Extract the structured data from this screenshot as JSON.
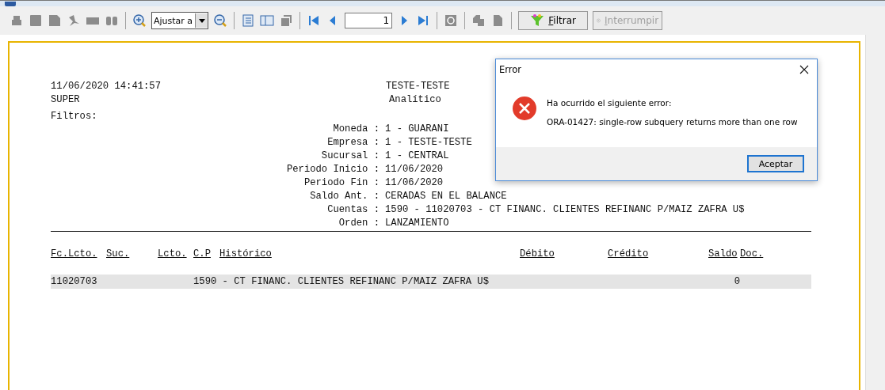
{
  "toolbar": {
    "zoom_select": {
      "value": "Ajustar a"
    },
    "page_field": {
      "value": "1"
    },
    "buttons": [
      {
        "label": "Filtrar",
        "disabled": false
      },
      {
        "label": "Interrumpir",
        "disabled": true
      }
    ]
  },
  "report": {
    "timestamp": "11/06/2020 14:41:57",
    "company": "TESTE-TESTE",
    "user": "SUPER",
    "report_type": "Analítico",
    "filters_label": "Filtros:",
    "filters": [
      {
        "label": "Moneda :",
        "value": "1 - GUARANI"
      },
      {
        "label": "Empresa :",
        "value": "1 - TESTE-TESTE"
      },
      {
        "label": "Sucursal :",
        "value": "1 - CENTRAL"
      },
      {
        "label": "Periodo Inicio :",
        "value": "11/06/2020"
      },
      {
        "label": "Periodo Fin :",
        "value": "11/06/2020"
      },
      {
        "label": "Saldo Ant. :",
        "value": "CERADAS EN EL BALANCE"
      },
      {
        "label": "Cuentas :",
        "value": "1590 - 11020703 - CT FINANC. CLIENTES REFINANC P/MAIZ ZAFRA U$"
      },
      {
        "label": "Orden :",
        "value": "LANZAMIENTO"
      }
    ],
    "columns": [
      "Fc.Lcto.",
      "Suc.",
      "Lcto.",
      "C.P",
      "Histórico",
      "Débito",
      "Crédito",
      "Saldo",
      "Doc."
    ],
    "rows": [
      {
        "cells": [
          "11020703",
          "",
          "",
          "1590 - CT FINANC. CLIENTES REFINANC P/MAIZ ZAFRA U$",
          "",
          "",
          "",
          "0",
          ""
        ]
      }
    ]
  },
  "dialog": {
    "title": "Error",
    "heading": "Ha ocurrido el siguiente error:",
    "message": "ORA-01427: single-row subquery returns more than one row",
    "button": "Aceptar"
  }
}
